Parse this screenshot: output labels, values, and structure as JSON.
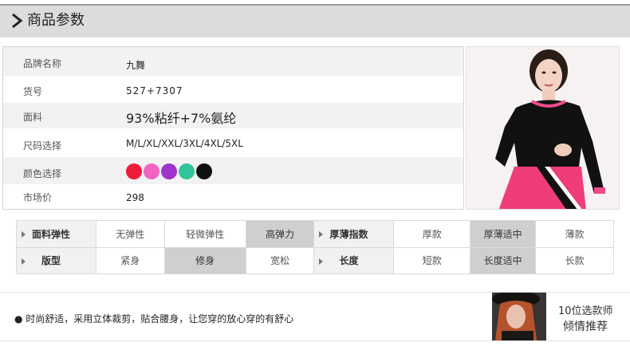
{
  "header": {
    "title": "商品参数"
  },
  "params": {
    "brand": {
      "label": "品牌名称",
      "value": "九舞"
    },
    "item_no": {
      "label": "货号",
      "value": "527+7307"
    },
    "fabric": {
      "label": "面料",
      "value": "93%粘纤+7%氨纶"
    },
    "sizes": {
      "label": "尺码选择",
      "value": "M/L/XL/XXL/3XL/4XL/5XL"
    },
    "colors": {
      "label": "颜色选择",
      "swatches": [
        "#ee1c3a",
        "#f062c3",
        "#a033cc",
        "#2fc49a",
        "#111111"
      ]
    },
    "price": {
      "label": "市场价",
      "value": "298"
    }
  },
  "attributes": {
    "row1": [
      {
        "header": "面料弹性",
        "options": [
          "无弹性",
          "轻微弹性",
          "高弹力"
        ],
        "selected": 2
      },
      {
        "header": "厚薄指数",
        "options": [
          "厚款",
          "厚薄适中",
          "薄款"
        ],
        "selected": 1
      }
    ],
    "row2": [
      {
        "header": "版型",
        "options": [
          "紧身",
          "修身",
          "宽松"
        ],
        "selected": 1
      },
      {
        "header": "长度",
        "options": [
          "短款",
          "长度适中",
          "长款"
        ],
        "selected": 1
      }
    ]
  },
  "banner": {
    "text": "● 时尚舒适，采用立体裁剪，贴合腰身，让您穿的放心穿的有舒心",
    "rec_line1": "10位选款师",
    "rec_line2": "倾情推荐"
  }
}
